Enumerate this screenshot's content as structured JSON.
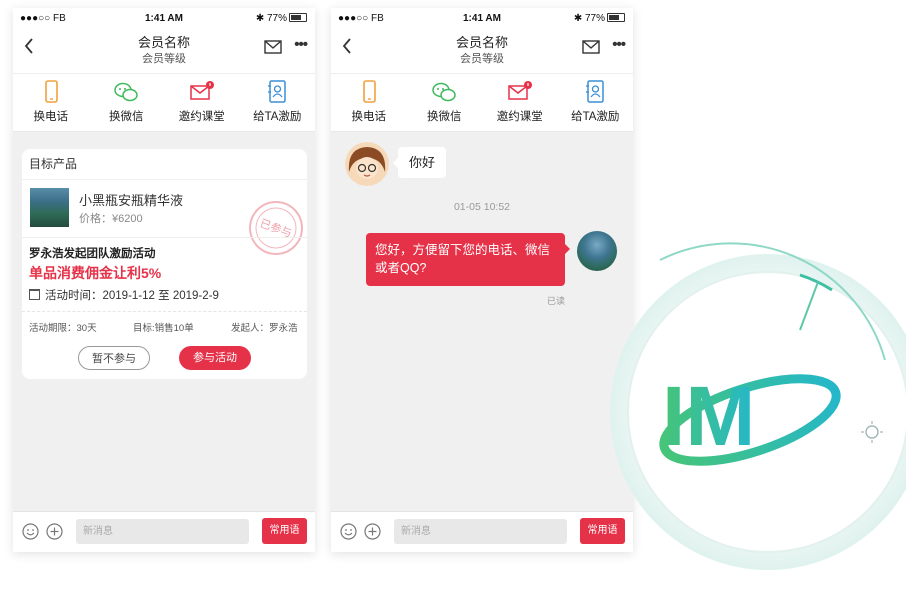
{
  "status_bar": {
    "carrier": "●●●○○ FB",
    "time": "1:41 AM",
    "battery": "77%"
  },
  "header": {
    "title": "会员名称",
    "subtitle": "会员等级",
    "back_icon": "chevron-left-icon",
    "mail_icon": "envelope-icon",
    "more_label": "•••"
  },
  "actions": [
    {
      "label": "换电话",
      "icon": "phone-icon",
      "color": "#f0a23c"
    },
    {
      "label": "换微信",
      "icon": "wechat-icon",
      "color": "#3cba5c"
    },
    {
      "label": "邀约课堂",
      "icon": "invite-mail-icon",
      "color": "#e63248"
    },
    {
      "label": "给TA激励",
      "icon": "contact-card-icon",
      "color": "#3b8fd6"
    }
  ],
  "card": {
    "header": "目标产品",
    "product_name": "小黑瓶安瓶精华液",
    "product_price": "价格：¥6200",
    "stamp_text": "已参与",
    "campaign_title": "罗永浩发起团队激励活动",
    "campaign_highlight": "单品消费佣金让利5%",
    "campaign_time": "活动时间：2019-1-12 至 2019-2-9",
    "meta_duration": "活动期限：30天",
    "meta_target": "目标:销售10单",
    "meta_initiator": "发起人：罗永浩",
    "decline_label": "暂不参与",
    "join_label": "参与活动"
  },
  "chat": {
    "incoming": "你好",
    "timestamp": "01-05 10:52",
    "outgoing_line1": "您好，方便留下您的电话、微信",
    "outgoing_line2": "或者QQ?",
    "read_status": "已读"
  },
  "chat_bar": {
    "emoji_icon": "smiley-icon",
    "plus_icon": "plus-circle-icon",
    "placeholder": "新消息",
    "phrases_label": "常用语"
  },
  "logo": {
    "text": "IM",
    "colors": [
      "#3cc08a",
      "#2bb5c8"
    ]
  },
  "colors": {
    "accent": "#e63248",
    "background": "#f0f0f0"
  }
}
